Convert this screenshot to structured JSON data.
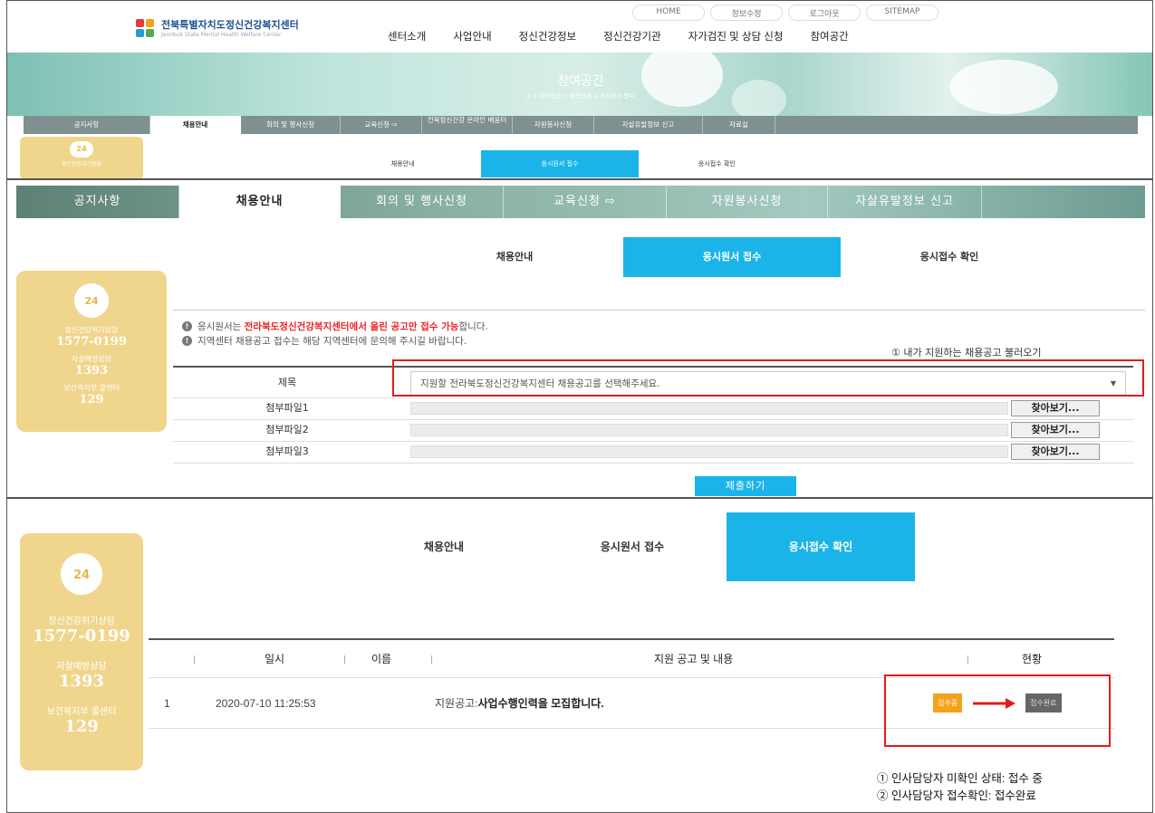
{
  "header": {
    "top_links": [
      "HOME",
      "정보수정",
      "로그아웃",
      "SITEMAP"
    ],
    "logo_ko": "전북특별자치도정신건강복지센터",
    "logo_en": "Jeonbuk State Mental Health Welfare Center",
    "gnb": [
      "센터소개",
      "사업안내",
      "정신건강정보",
      "정신건강기관",
      "자가검진 및 상담 신청",
      "참여공간"
    ],
    "hero_title": "참여공간",
    "breadcrumb": "> 참여공간 > 채용안내 > 응시원서 접수"
  },
  "subnav": [
    "공지사항",
    "채용안내",
    "회의 및 행사신청",
    "교육신청",
    "전북정신건강 온라인 배움터",
    "자원봉사신청",
    "자살유발정보 신고",
    "자료실"
  ],
  "subnav_zoom": [
    "공지사항",
    "채용안내",
    "회의 및 행사신청",
    "교육신청",
    "자원봉사신청",
    "자살유발정보 신고"
  ],
  "tabs": [
    "채용안내",
    "응시원서 접수",
    "응시접수 확인"
  ],
  "hotline": {
    "crisis_label": "정신건강위기상담",
    "crisis_num": "1577-0199",
    "suicide_label": "자살예방상담",
    "suicide_num": "1393",
    "welfare_label": "보건복지부 콜센터",
    "welfare_num": "129"
  },
  "form": {
    "notice1_pre": "응시원서는 ",
    "notice1_red": "전라북도정신건강복지센터에서 올린 공고만 접수 가능",
    "notice1_post": "합니다.",
    "notice2": "지역센터 채용공고 접수는 해당 지역센터에 문의해 주시길 바랍니다.",
    "load_link": "① 내가 지원하는 채용공고 불러오기",
    "title_label": "제목",
    "title_placeholder": "지원할 전라북도정신건강복지센터 채용공고를 선택해주세요.",
    "files": [
      "첨부파일1",
      "첨부파일2",
      "첨부파일3"
    ],
    "browse": "찾아보기...",
    "submit": "제출하기"
  },
  "table": {
    "headers": [
      "일시",
      "이름",
      "지원 공고 및 내용",
      "현황"
    ],
    "row": {
      "no": "1",
      "date": "2020-07-10 11:25:53",
      "content_prefix": "지원공고: ",
      "content_bold": "사업수행인력을 모집합니다.",
      "status_from": "접수중",
      "status_to": "접수완료"
    }
  },
  "legend": [
    "① 인사담당자 미확인 상태: 접수 중",
    "② 인사담당자 접수확인: 접수완료"
  ],
  "colors": {
    "accent": "#1bb4e8",
    "hotline": "#f0d68c",
    "highlight": "#e21b1b",
    "pending": "#f5a11b"
  }
}
